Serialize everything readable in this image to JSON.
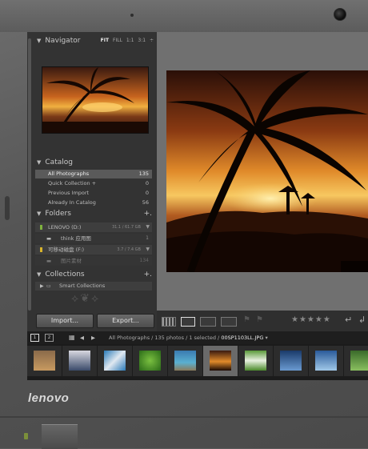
{
  "brand": {
    "logo_text": "lenovo"
  },
  "navigator": {
    "title": "Navigator",
    "options": [
      "FIT",
      "FILL",
      "1:1",
      "3:1 ÷"
    ]
  },
  "catalog": {
    "title": "Catalog",
    "items": [
      {
        "label": "All Photographs",
        "count": "135",
        "selected": true
      },
      {
        "label": "Quick Collection +",
        "count": "0"
      },
      {
        "label": "Previous Import",
        "count": "0"
      },
      {
        "label": "Already In Catalog",
        "count": "56"
      }
    ]
  },
  "folders": {
    "title": "Folders",
    "add_label": "+.",
    "items": [
      {
        "label": "LENOVO (D:)",
        "size": "31.1 / 61.7 GB"
      },
      {
        "label": "think 应用图",
        "count": "1"
      },
      {
        "label": "可移动磁盘 (F:)",
        "size": "3.7 / 7.4 GB"
      },
      {
        "label": "图片素材",
        "count": "134"
      }
    ]
  },
  "collections": {
    "title": "Collections",
    "add_label": "+.",
    "items": [
      {
        "label": "Smart Collections"
      }
    ]
  },
  "buttons": {
    "import": "Import...",
    "export": "Export..."
  },
  "toolbar": {
    "stars": "★★★★★"
  },
  "filmstrip_bar": {
    "page1": "1",
    "page2": "2",
    "source": "All Photographs",
    "summary": " / 135 photos / 1 selected / ",
    "filename": "00SP1103LL.JPG",
    "dropdown": "▾"
  },
  "colors": {
    "accent_green": "#7fb23e",
    "accent_yellow": "#d8b42b",
    "panel_bg": "#333333"
  }
}
